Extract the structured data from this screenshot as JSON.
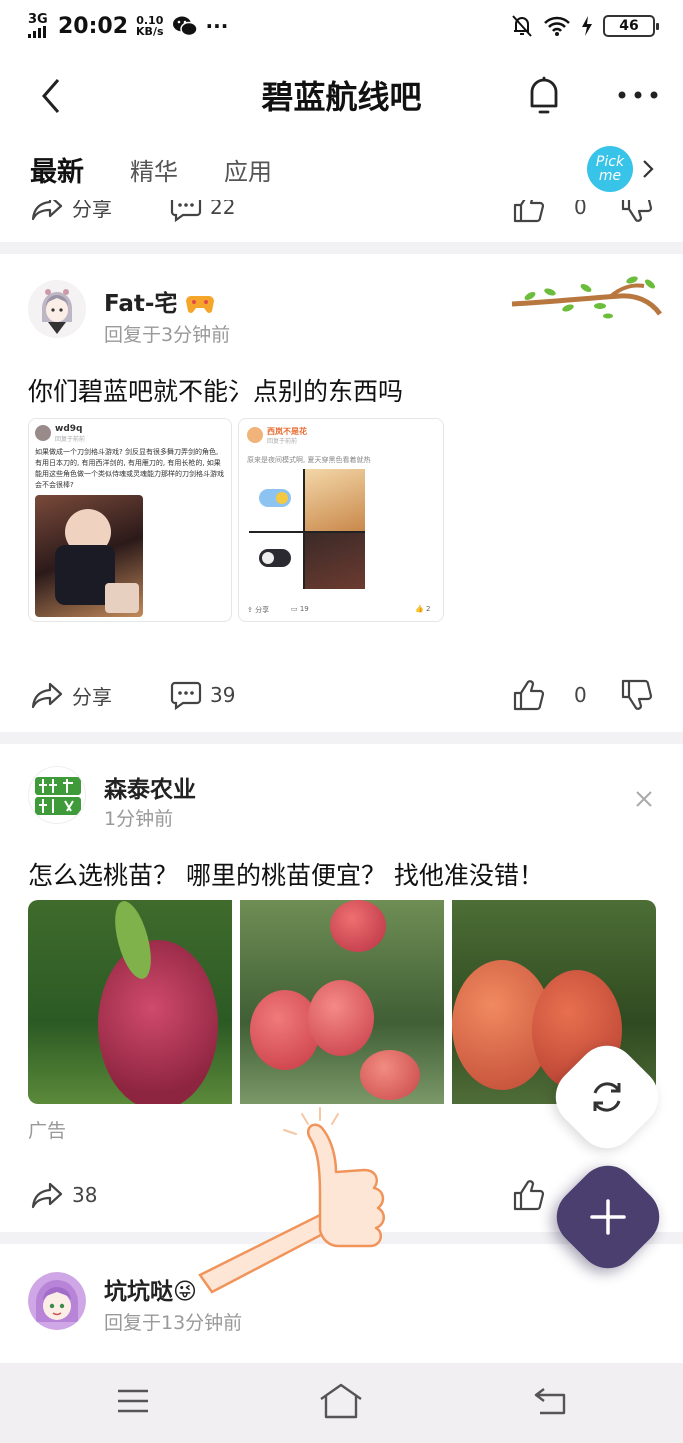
{
  "status_bar": {
    "network": "3G",
    "time": "20:02",
    "speed_value": "0.10",
    "speed_unit": "KB/s",
    "battery": "46"
  },
  "header": {
    "title": "碧蓝航线吧"
  },
  "tabs": [
    {
      "label": "最新",
      "active": true
    },
    {
      "label": "精华",
      "active": false
    },
    {
      "label": "应用",
      "active": false
    }
  ],
  "pick_me": "Pick me",
  "top_partial_card": {
    "share_label": "分享",
    "comment_count": "22",
    "like_count": "0"
  },
  "post1": {
    "username": "Fat-宅",
    "meta": "回复于3分钟前",
    "text": "你们碧蓝吧就不能\u0002点别的东西吗",
    "text_display": "你们碧蓝吧就不能氵点别的东西吗",
    "left_shot": {
      "user": "wd9q",
      "sub": "回复于前前",
      "body": "如果做成一个刀剑格斗游戏? 剑反显有很多舞刀弄剑的角色, 有用日本刀的, 有用西洋剑的, 有用雁刀的, 有用长枪的, 如果能用这些角色做一个类似侍魂或灵魂能力那样的刀剑格斗游戏会不会很棒?"
    },
    "right_shot": {
      "user": "西岚不是花",
      "sub": "回复于前前",
      "body": "原来是夜间模式啊, 夏天穿黑色看着就热",
      "share": "分享",
      "comments": "19",
      "likes": "2"
    },
    "share_label": "分享",
    "comment_count": "39",
    "like_count": "0"
  },
  "ad_post": {
    "username": "森泰农业",
    "meta": "1分钟前",
    "text": "怎么选桃苗？ 哪里的桃苗便宜？ 找他准没错！",
    "ad_label": "广告",
    "share_count": "38"
  },
  "post3": {
    "username": "坑坑哒😜",
    "meta": "回复于13分钟前"
  },
  "colors": {
    "accent": "#4a3f6e",
    "pick_me": "#38c3e8",
    "ad_green": "#3f9a3a"
  }
}
